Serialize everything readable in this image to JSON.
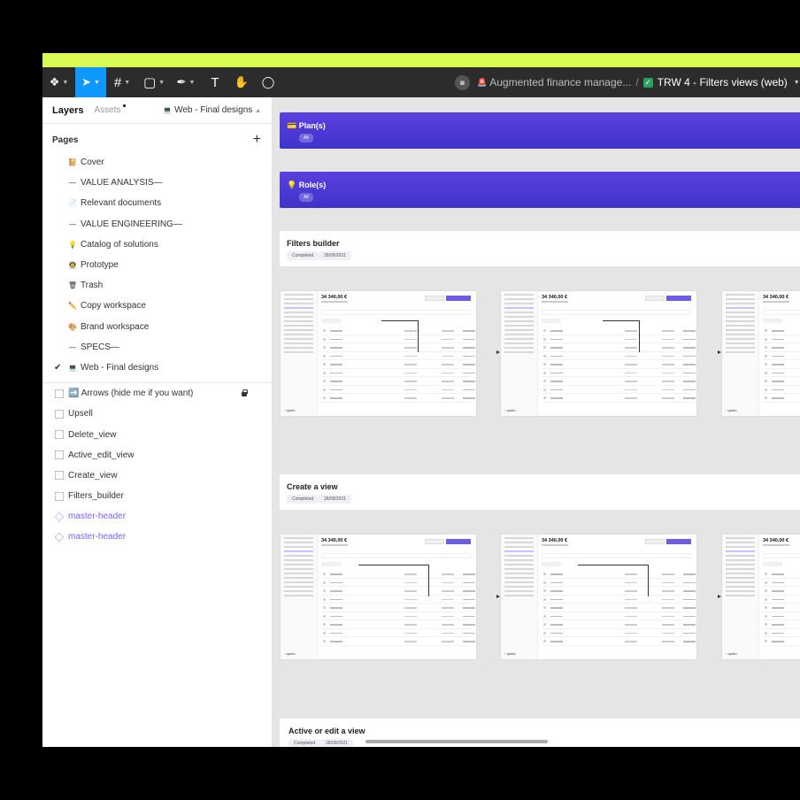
{
  "toolbar": {
    "tools": [
      {
        "name": "main-menu",
        "glyph": "❖"
      },
      {
        "name": "move-tool",
        "glyph": "➤"
      },
      {
        "name": "frame-tool",
        "glyph": "#"
      },
      {
        "name": "shape-tool",
        "glyph": "▢"
      },
      {
        "name": "pen-tool",
        "glyph": "✒"
      },
      {
        "name": "text-tool",
        "glyph": "T"
      },
      {
        "name": "hand-tool",
        "glyph": "✋"
      },
      {
        "name": "comment-tool",
        "glyph": "◯"
      }
    ],
    "project": "Augmented finance manage...",
    "project_icon": "🚨",
    "separator": "/",
    "file_name": "TRW 4 - Filters views (web)"
  },
  "sidebar": {
    "tab_layers": "Layers",
    "tab_assets": "Assets",
    "current_page": "Web - Final designs",
    "pages_title": "Pages",
    "pages": [
      {
        "icon": "📔",
        "label": "Cover"
      },
      {
        "icon": "—",
        "label": "VALUE ANALYSIS",
        "suffix": " —"
      },
      {
        "icon": "📄",
        "label": "Relevant documents"
      },
      {
        "icon": "—",
        "label": "VALUE ENGINEERING",
        "suffix": " —"
      },
      {
        "icon": "💡",
        "label": "Catalog of solutions"
      },
      {
        "icon": "👨‍🚀",
        "label": "Prototype"
      },
      {
        "icon": "🗑",
        "label": "Trash"
      },
      {
        "icon": "✏️",
        "label": "Copy workspace"
      },
      {
        "icon": "🎨",
        "label": "Brand workspace"
      },
      {
        "icon": "—",
        "label": "SPECS",
        "suffix": " —"
      },
      {
        "icon": "💻",
        "label": "Web - Final designs",
        "checked": true
      }
    ],
    "layers": [
      {
        "label": "➡️ Arrows (hide me if you want)",
        "locked": true
      },
      {
        "label": "Upsell"
      },
      {
        "label": "Delete_view"
      },
      {
        "label": "Active_edit_view"
      },
      {
        "label": "Create_view"
      },
      {
        "label": "Filters_builder"
      },
      {
        "label": "master-header",
        "component": true
      },
      {
        "label": "master-header",
        "component": true
      }
    ]
  },
  "canvas": {
    "banners": [
      {
        "icon": "💳",
        "title": "Plan(s)",
        "pill": "All"
      },
      {
        "icon": "💡",
        "title": "Role(s)",
        "pill": "All"
      }
    ],
    "sections": [
      {
        "title": "Filters builder",
        "status": "Completed",
        "date": "28/09/2021"
      },
      {
        "title": "Create a view",
        "status": "Completed",
        "date": "28/09/2021"
      },
      {
        "title": "Active or edit a view",
        "status": "Completed",
        "date": "28/09/2021"
      }
    ],
    "frame_amount": "34 340,00 €",
    "frame_logo": "◦ qonto"
  }
}
